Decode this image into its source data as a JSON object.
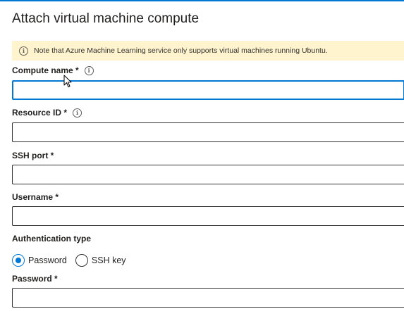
{
  "page": {
    "title": "Attach virtual machine compute"
  },
  "notice": {
    "text": "Note that Azure Machine Learning service only supports virtual machines running Ubuntu.",
    "icon": "info-icon"
  },
  "fields": {
    "compute_name": {
      "label": "Compute name *",
      "value": "",
      "focused": true
    },
    "resource_id": {
      "label": "Resource ID *",
      "value": ""
    },
    "ssh_port": {
      "label": "SSH port *",
      "value": ""
    },
    "username": {
      "label": "Username *",
      "value": ""
    },
    "password": {
      "label": "Password *",
      "value": ""
    }
  },
  "auth": {
    "label": "Authentication type",
    "options": [
      {
        "label": "Password",
        "selected": true
      },
      {
        "label": "SSH key",
        "selected": false
      }
    ]
  },
  "colors": {
    "accent": "#0078d4",
    "notice_bg": "#fff4ce",
    "text": "#201f1e"
  }
}
